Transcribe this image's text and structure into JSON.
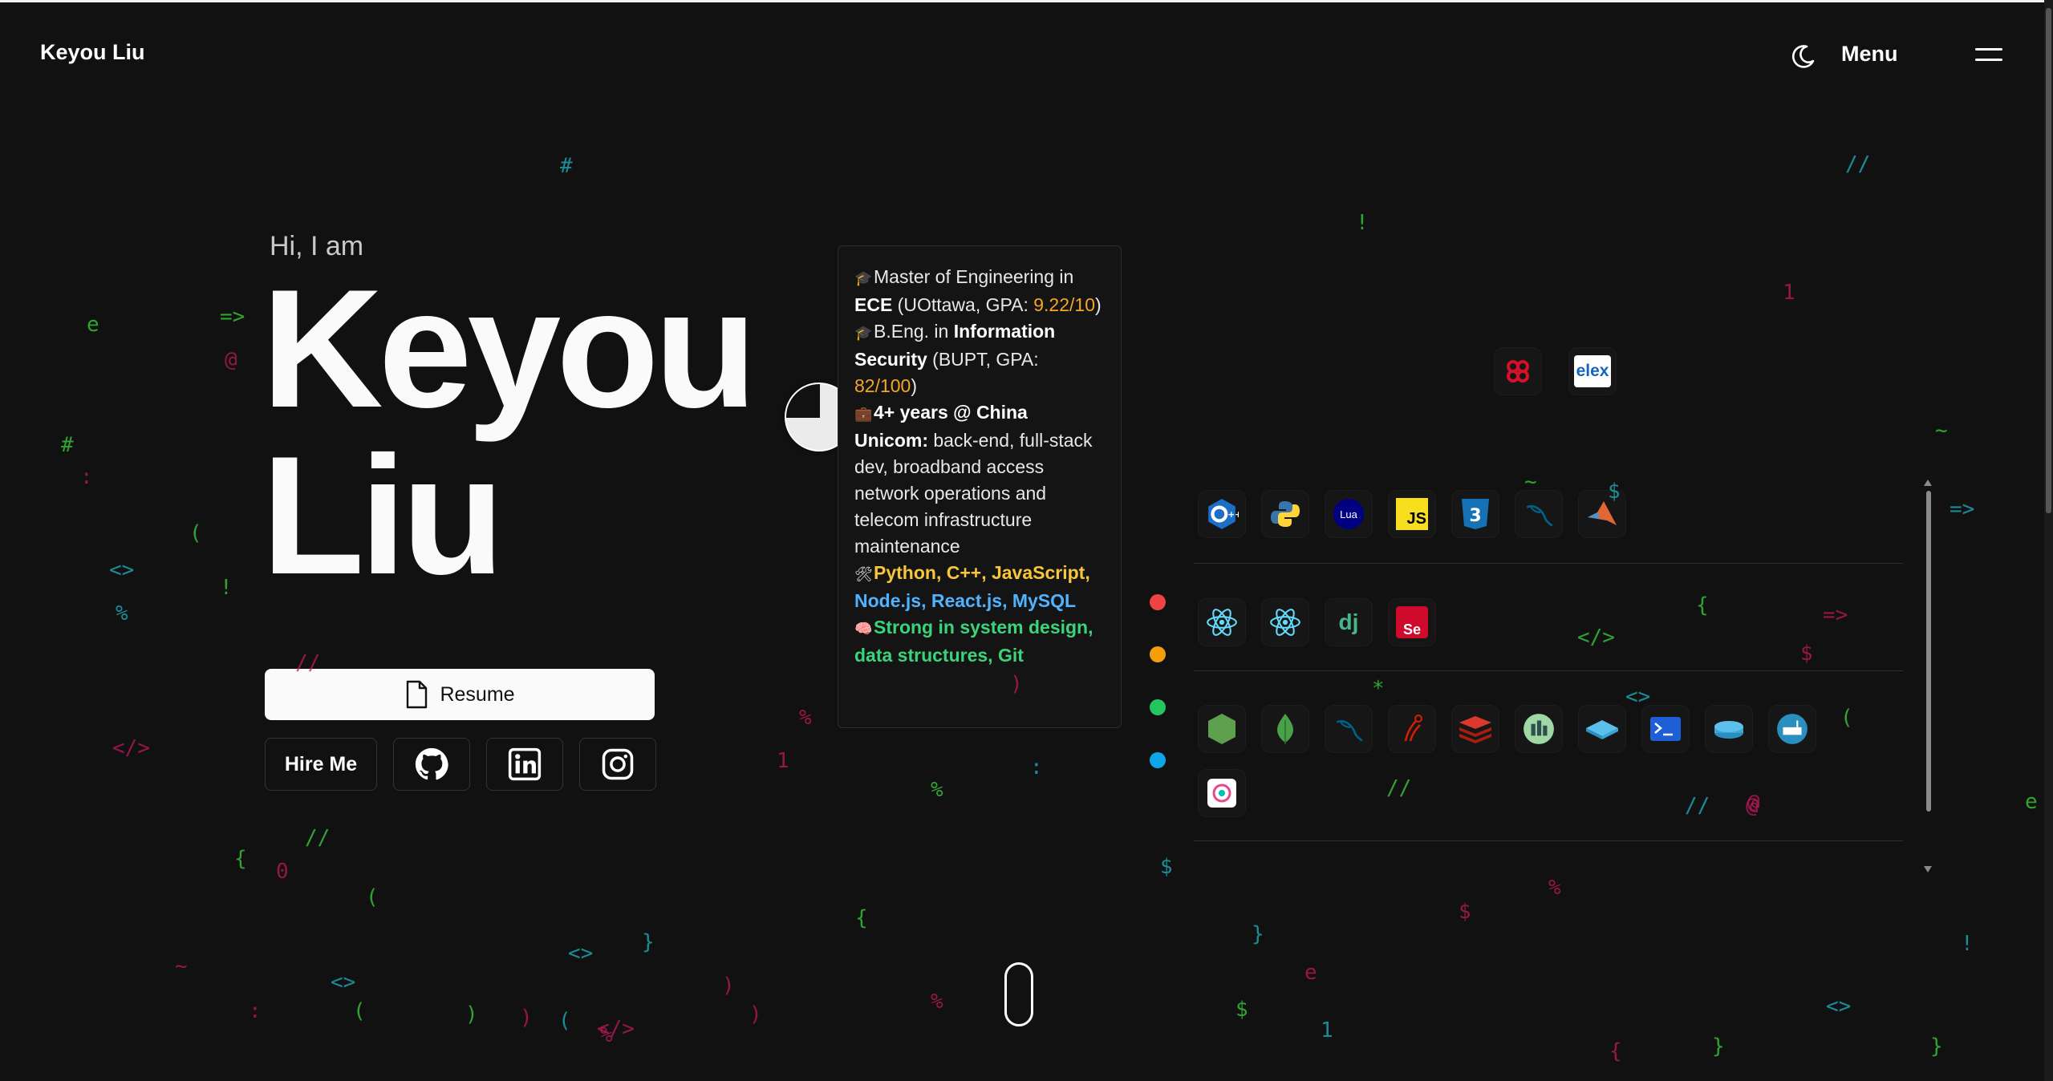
{
  "header": {
    "brand": "Keyou Liu",
    "menu_label": "Menu",
    "theme_toggle_icon": "moon-icon",
    "menu_icon": "hamburger-icon"
  },
  "hero": {
    "greeting": "Hi, I am",
    "name_line1": "Keyou",
    "name_line2": "Liu",
    "resume_label": "Resume",
    "hire_label": "Hire Me",
    "social_icons": [
      "github-icon",
      "linkedin-icon",
      "instagram-icon"
    ]
  },
  "about": {
    "edu1_a": "Master of Engineering in ",
    "edu1_b": "ECE",
    "edu1_c": " (UOttawa, GPA: ",
    "edu1_gpa": "9.22/10",
    "edu1_d": ")",
    "edu2_a": "B.Eng. in ",
    "edu2_b": "Information Security",
    "edu2_c": " (BUPT, GPA: ",
    "edu2_gpa": "82/100",
    "edu2_d": ")",
    "work_a": "4+ years @ China Unicom:",
    "work_b": " back-end, full-stack dev, broadband access network operations and telecom infrastructure maintenance",
    "skills_a": "Python, C++, JavaScript,",
    "skills_b": " Node.js, React.js, MySQL",
    "strengths": "Strong in system design, data structures, Git"
  },
  "legend_dot_colors": [
    "#ef4444",
    "#f59e0b",
    "#22c55e",
    "#0ea5e9"
  ],
  "tech_icons": {
    "row0": [
      "unicom-icon",
      "elex-icon"
    ],
    "row1": [
      "cplusplus-icon",
      "python-icon",
      "lua-icon",
      "javascript-icon",
      "css3-icon",
      "mysql-icon",
      "matlab-icon"
    ],
    "row2": [
      "react-icon",
      "react-native-icon",
      "django-icon",
      "selenium-icon"
    ],
    "row3": [
      "nodejs-icon",
      "mongodb-icon",
      "mysql-db-icon",
      "sqlalchemy-icon",
      "redis-icon",
      "prometheus-icon",
      "switch-icon",
      "terminal-icon",
      "router-icon",
      "gateway-icon",
      "kibana-icon"
    ],
    "lua_label": "Lua",
    "js_label": "JS",
    "elex_label": "elex",
    "dj_label": "dj",
    "se_label": "Se"
  },
  "bg_symbols": [
    "#",
    "//",
    "!",
    "e",
    "=>",
    "@",
    "1",
    "#",
    ":",
    "(",
    "<>",
    "!",
    "%",
    "//",
    "</>",
    "//",
    "{",
    "0",
    "(",
    "<>",
    "~",
    ")",
    "(",
    "</>",
    "%",
    "%",
    "1",
    ":",
    "{",
    "}",
    ")",
    "e",
    "//",
    "1",
    "{",
    "}",
    "<>",
    "}",
    "!",
    "e",
    "$",
    "$",
    "%",
    "//",
    "@",
    "}",
    "{",
    ")",
    "(",
    "~",
    "=>",
    "$",
    "*",
    "<>",
    "</>",
    "=>",
    "$",
    ")",
    ":",
    "$",
    "@",
    "%",
    "~",
    "%",
    ")",
    "(",
    "<>"
  ]
}
